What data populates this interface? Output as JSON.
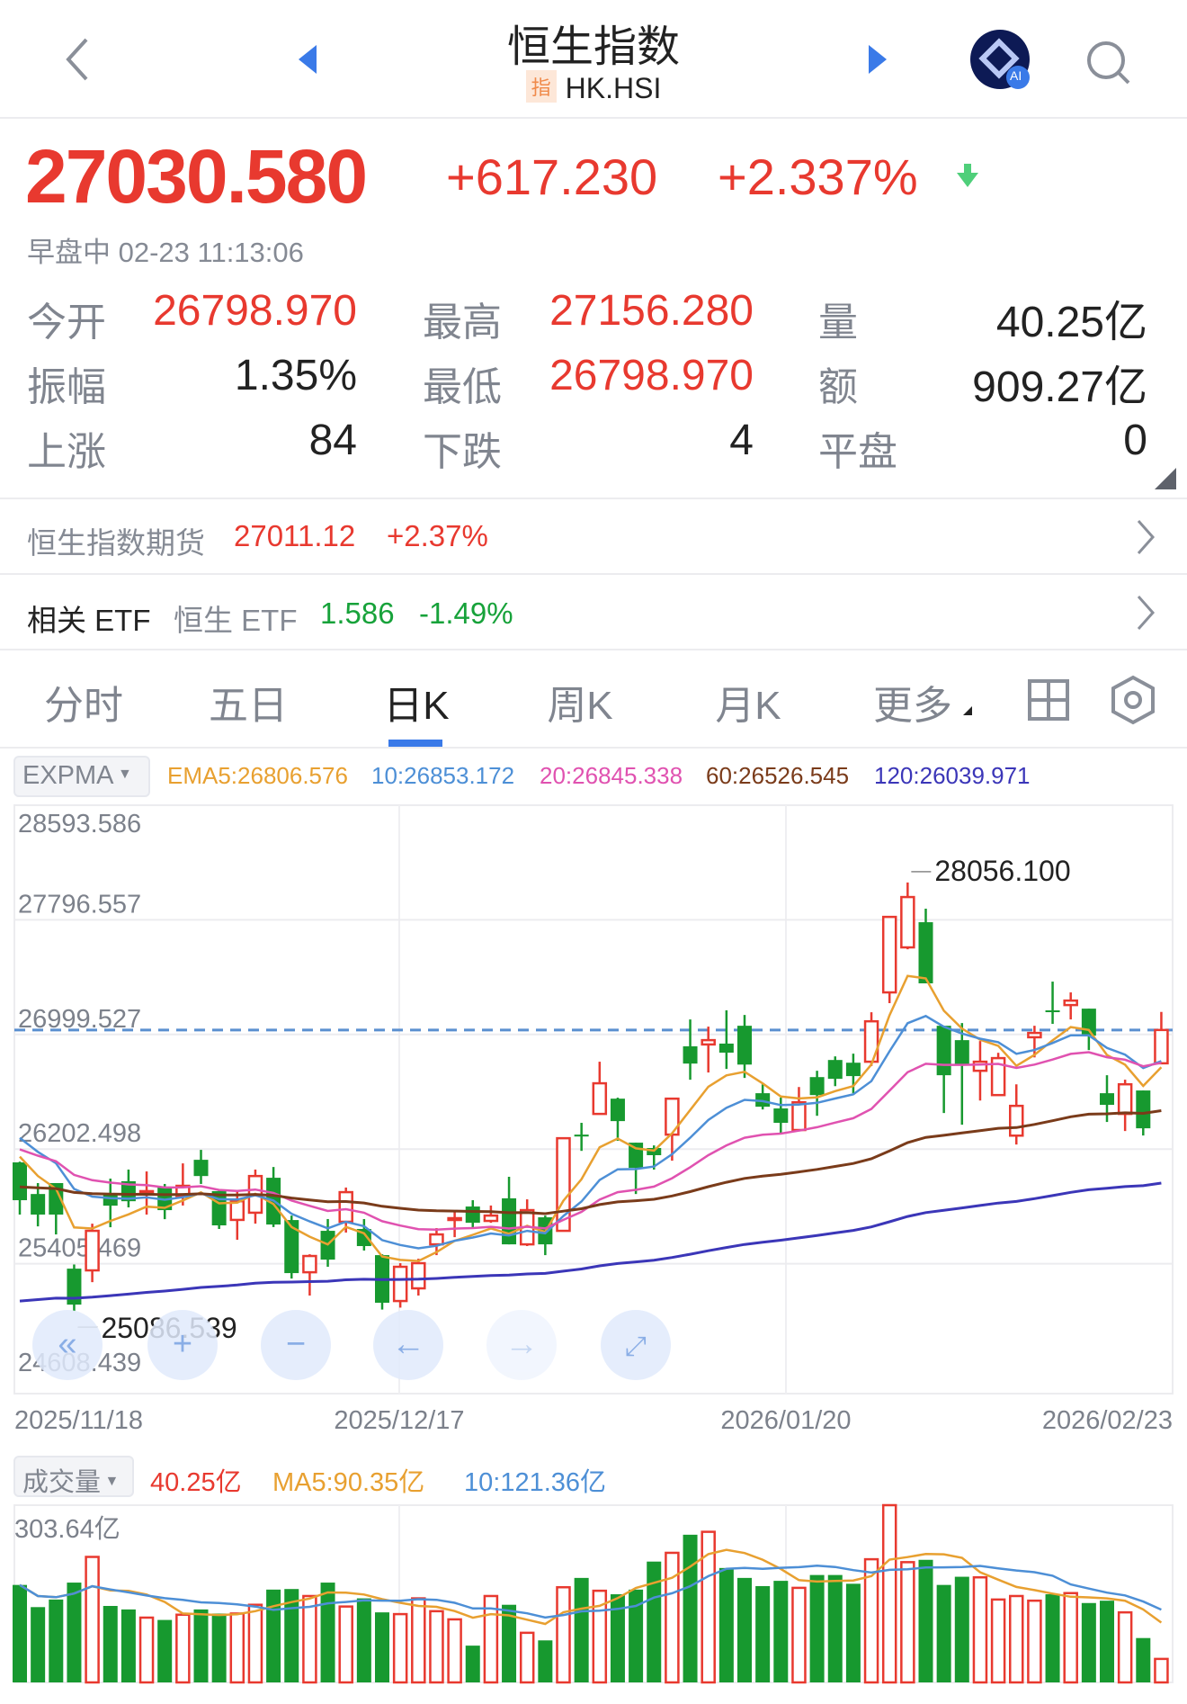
{
  "header": {
    "title": "恒生指数",
    "badge": "指",
    "symbol": "HK.HSI",
    "ai_badge": "AI"
  },
  "quote": {
    "price": "27030.580",
    "change": "+617.230",
    "change_pct": "+2.337%",
    "status": "早盘中 02-23 11:13:06",
    "stats": [
      {
        "label": "今开",
        "value": "26798.970",
        "color": "red"
      },
      {
        "label": "最高",
        "value": "27156.280",
        "color": "red"
      },
      {
        "label": "量",
        "value": "40.25亿",
        "color": "dark"
      },
      {
        "label": "振幅",
        "value": "1.35%",
        "color": "dark"
      },
      {
        "label": "最低",
        "value": "26798.970",
        "color": "red"
      },
      {
        "label": "额",
        "value": "909.27亿",
        "color": "dark"
      },
      {
        "label": "上涨",
        "value": "84",
        "color": "dark"
      },
      {
        "label": "下跌",
        "value": "4",
        "color": "dark"
      },
      {
        "label": "平盘",
        "value": "0",
        "color": "dark"
      }
    ]
  },
  "futures": {
    "label": "恒生指数期货",
    "price": "27011.12",
    "change": "+2.37%"
  },
  "etf": {
    "label": "相关 ETF",
    "name": "恒生 ETF",
    "price": "1.586",
    "change": "-1.49%"
  },
  "tabs": [
    {
      "label": "分时"
    },
    {
      "label": "五日"
    },
    {
      "label": "日K",
      "active": true
    },
    {
      "label": "周K"
    },
    {
      "label": "月K"
    },
    {
      "label": "更多"
    }
  ],
  "colors": {
    "up": "#e8392f",
    "down": "#17992f",
    "ema5": "#e8a030",
    "ema10": "#4d8fd6",
    "ema20": "#e052b0",
    "ema60": "#7a3b1a",
    "ema120": "#3b36b8",
    "accent": "#3a7ae8"
  },
  "chart_data": [
    {
      "type": "candlestick",
      "indicator": "EXPMA",
      "legend": {
        "ema5": "EMA5:26806.576",
        "ema10": "10:26853.172",
        "ema20": "20:26845.338",
        "ema60": "60:26526.545",
        "ema120": "120:26039.971"
      },
      "ylim": [
        24608.439,
        28593.586
      ],
      "ytick_labels": [
        "28593.586",
        "27796.557",
        "26999.527",
        "26202.498",
        "25405.469",
        "24608.439"
      ],
      "ytick_values": [
        28593.586,
        27796.557,
        26999.527,
        26202.498,
        25405.469,
        24608.439
      ],
      "x_labels": [
        "2025/11/18",
        "2025/12/17",
        "2026/01/20",
        "2026/02/23"
      ],
      "high_label": "28056.100",
      "low_label": "25086.539",
      "current_price": 27030.58,
      "ema_initial": {
        "ema5": 26150,
        "ema10": 26280,
        "ema20": 26200,
        "ema60": 25940,
        "ema120": 25146
      },
      "candles_ohlc": [
        [
          26110,
          26115,
          25747,
          25847
        ],
        [
          25890,
          25966,
          25665,
          25747
        ],
        [
          25966,
          25966,
          25609,
          25747
        ],
        [
          25371,
          25400,
          25077,
          25121
        ],
        [
          25359,
          25684,
          25277,
          25634
        ],
        [
          25890,
          25997,
          25659,
          25809
        ],
        [
          25979,
          26060,
          25797,
          25840
        ],
        [
          25897,
          26047,
          25747,
          25910
        ],
        [
          25935,
          25960,
          25715,
          25778
        ],
        [
          25872,
          26103,
          25810,
          25947
        ],
        [
          26128,
          26197,
          25960,
          26015
        ],
        [
          25910,
          25922,
          25647,
          25672
        ],
        [
          25710,
          25916,
          25572,
          25840
        ],
        [
          25760,
          26060,
          25684,
          26015
        ],
        [
          26003,
          26078,
          25660,
          25678
        ],
        [
          25709,
          25740,
          25302,
          25340
        ],
        [
          25346,
          25471,
          25184,
          25459
        ],
        [
          25634,
          25716,
          25384,
          25434
        ],
        [
          25697,
          25935,
          25622,
          25903
        ],
        [
          25647,
          25716,
          25497,
          25528
        ],
        [
          25465,
          25471,
          25086.539,
          25134
        ],
        [
          25146,
          25409,
          25100,
          25384
        ],
        [
          25234,
          25440,
          25184,
          25409
        ],
        [
          25540,
          25653,
          25465,
          25609
        ],
        [
          25722,
          25766,
          25590,
          25722
        ],
        [
          25803,
          25847,
          25647,
          25690
        ],
        [
          25703,
          25810,
          25690,
          25740
        ],
        [
          25860,
          26010,
          25540,
          25540
        ],
        [
          25540,
          25853,
          25528,
          25778
        ],
        [
          25728,
          25740,
          25465,
          25540
        ],
        [
          25634,
          26278,
          25634,
          26278
        ],
        [
          26303,
          26385,
          26190,
          26290
        ],
        [
          26447,
          26810,
          26447,
          26660
        ],
        [
          26553,
          26560,
          26260,
          26397
        ],
        [
          26247,
          26247,
          25890,
          26072
        ],
        [
          26210,
          26228,
          26060,
          26160
        ],
        [
          26303,
          26560,
          26122,
          26553
        ],
        [
          26917,
          27104,
          26685,
          26797
        ],
        [
          26930,
          27054,
          26735,
          26960
        ],
        [
          26936,
          27167,
          26760,
          26873
        ],
        [
          27060,
          27135,
          26697,
          26790
        ],
        [
          26591,
          26653,
          26478,
          26497
        ],
        [
          26485,
          26560,
          26310,
          26385
        ],
        [
          26335,
          26634,
          26335,
          26528
        ],
        [
          26703,
          26747,
          26434,
          26578
        ],
        [
          26822,
          26847,
          26640,
          26691
        ],
        [
          26803,
          26866,
          26591,
          26710
        ],
        [
          26810,
          27154,
          26780,
          27091
        ],
        [
          27292,
          27817,
          27217,
          27817
        ],
        [
          27605,
          28056.1,
          27592,
          27955
        ],
        [
          27780,
          27874,
          27355,
          27355
        ],
        [
          27060,
          27060,
          26453,
          26716
        ],
        [
          26960,
          27079,
          26372,
          26791
        ],
        [
          26747,
          26954,
          26540,
          26810
        ],
        [
          26578,
          26872,
          26578,
          26835
        ],
        [
          26296,
          26653,
          26234,
          26503
        ],
        [
          26980,
          27060,
          26840,
          27010
        ],
        [
          27167,
          27367,
          27073,
          27160
        ],
        [
          27204,
          27292,
          27104,
          27235
        ],
        [
          27179,
          27179,
          26891,
          26991
        ],
        [
          26591,
          26716,
          26391,
          26510
        ],
        [
          26447,
          26685,
          26328,
          26653
        ],
        [
          26610,
          26610,
          26297,
          26347
        ],
        [
          26798.97,
          27156.28,
          26798.97,
          27030.58
        ]
      ]
    },
    {
      "type": "bar",
      "indicator": "成交量",
      "legend": {
        "vol": "40.25亿",
        "ma5": "MA5:90.35亿",
        "ma10": "10:121.36亿"
      },
      "unit": "亿",
      "ymax": 303.64,
      "ymax_label": "303.64亿",
      "values": [
        167,
        129,
        142,
        171,
        215,
        131,
        125,
        111,
        107,
        116,
        125,
        118,
        118,
        133,
        159,
        160,
        148,
        171,
        130,
        144,
        120,
        117,
        144,
        122,
        108,
        63,
        148,
        133,
        85,
        72,
        163,
        179,
        157,
        151,
        159,
        207,
        222,
        253,
        258,
        196,
        179,
        165,
        174,
        162,
        184,
        184,
        169,
        211,
        303.64,
        206,
        210,
        167,
        181,
        180,
        142,
        148,
        140,
        151,
        153,
        136,
        140,
        120,
        76,
        40.25
      ]
    }
  ]
}
